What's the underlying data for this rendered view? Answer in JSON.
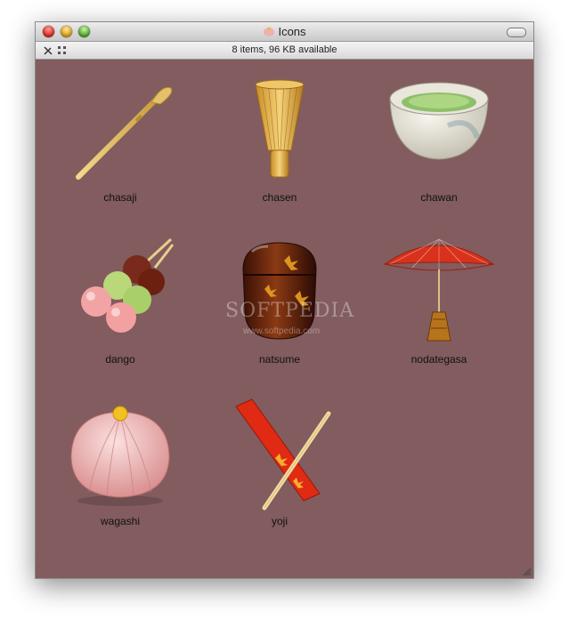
{
  "window": {
    "title": "Icons"
  },
  "status": {
    "text": "8 items, 96 KB available"
  },
  "watermark": {
    "main": "SOFTPEDIA",
    "sub": "www.softpedia.com"
  },
  "icons": [
    {
      "name": "chasaji",
      "icon": "tea-scoop-icon"
    },
    {
      "name": "chasen",
      "icon": "tea-whisk-icon"
    },
    {
      "name": "chawan",
      "icon": "tea-bowl-icon"
    },
    {
      "name": "dango",
      "icon": "dango-icon"
    },
    {
      "name": "natsume",
      "icon": "tea-caddy-icon"
    },
    {
      "name": "nodategasa",
      "icon": "parasol-icon"
    },
    {
      "name": "wagashi",
      "icon": "sweet-icon"
    },
    {
      "name": "yoji",
      "icon": "pick-icon"
    }
  ],
  "colors": {
    "background": "#825c5e",
    "parasol": "#d8321c",
    "lacquer": "#6b2410"
  }
}
